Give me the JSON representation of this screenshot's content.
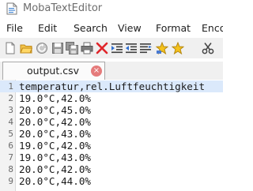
{
  "window": {
    "title": "MobaTextEditor"
  },
  "menu": {
    "items": [
      {
        "label": "File"
      },
      {
        "label": "Edit"
      },
      {
        "label": "Search"
      },
      {
        "label": "View"
      },
      {
        "label": "Format"
      },
      {
        "label": "Enco"
      }
    ]
  },
  "toolbar": {
    "icons": [
      "new-file-icon",
      "open-folder-icon",
      "reload-icon",
      "save-icon",
      "save-all-icon",
      "print-icon",
      "close-file-icon",
      "indent-icon",
      "outdent-icon",
      "wrap-icon",
      "bookmark-icon",
      "favorite-icon",
      "cut-icon"
    ]
  },
  "tabs": [
    {
      "label": "output.csv",
      "close": "×"
    }
  ],
  "editor": {
    "lines": [
      {
        "num": "1",
        "text": "temperatur,rel.Luftfeuchtigkeit"
      },
      {
        "num": "2",
        "text": "19.0°C,42.0%"
      },
      {
        "num": "3",
        "text": "20.0°C,45.0%"
      },
      {
        "num": "4",
        "text": "20.0°C,42.0%"
      },
      {
        "num": "5",
        "text": "20.0°C,43.0%"
      },
      {
        "num": "6",
        "text": "19.0°C,42.0%"
      },
      {
        "num": "7",
        "text": "19.0°C,43.0%"
      },
      {
        "num": "8",
        "text": "20.0°C,42.0%"
      },
      {
        "num": "9",
        "text": "20.0°C,44.0%"
      }
    ]
  }
}
